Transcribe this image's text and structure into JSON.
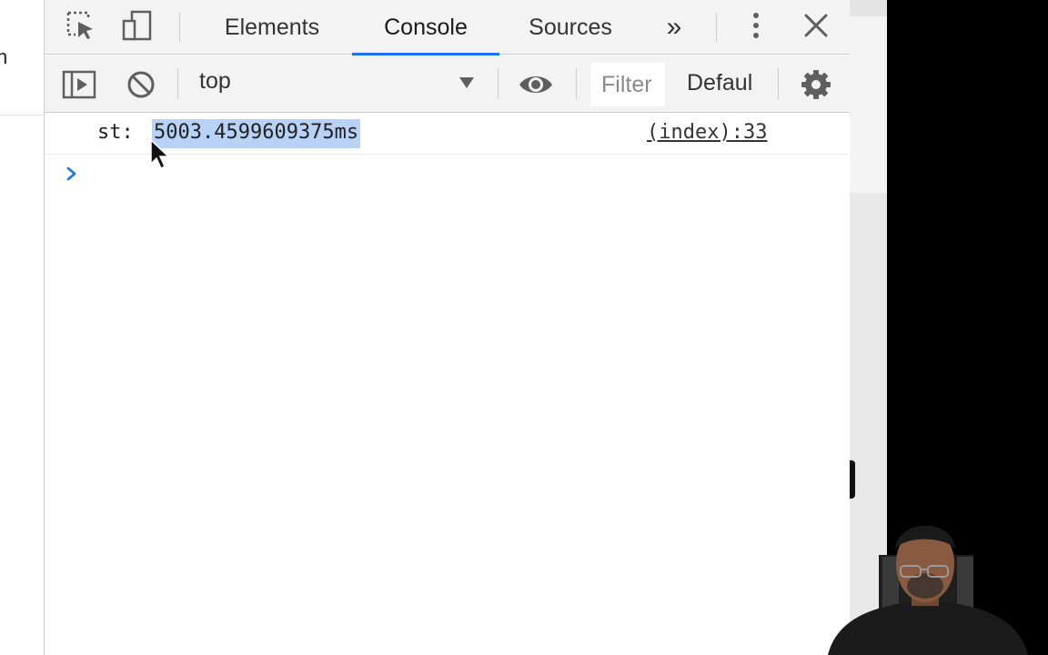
{
  "devtools": {
    "tabs": [
      {
        "label": "Elements",
        "active": false
      },
      {
        "label": "Console",
        "active": true
      },
      {
        "label": "Sources",
        "active": false
      }
    ],
    "more_tabs_glyph": "»",
    "icons": [
      "inspect-element-icon",
      "device-toolbar-icon",
      "more-tabs-icon",
      "kebab-menu-icon",
      "close-icon"
    ]
  },
  "toolbar": {
    "context": "top",
    "filter_placeholder": "Filter",
    "levels_label": "Defaul",
    "icons": [
      "sidebar-toggle-icon",
      "clear-console-icon",
      "live-expression-icon",
      "settings-gear-icon"
    ]
  },
  "console": {
    "message_prefix": "st:",
    "message_value": "5003.4599609375ms",
    "message_source": "(index):33",
    "prompt_glyph": "›"
  },
  "left_page": {
    "edge_text": "n"
  },
  "colors": {
    "accent": "#1a73e8",
    "selection": "#b8d2f5",
    "toolbar_bg": "#f3f3f3"
  }
}
